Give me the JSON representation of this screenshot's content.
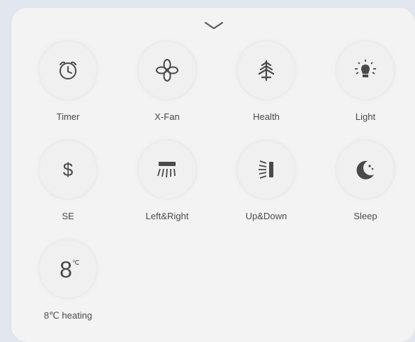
{
  "panel": {
    "collapse_icon": "chevron-down-icon"
  },
  "functions": [
    {
      "label": "Timer",
      "icon": "alarm-clock-icon"
    },
    {
      "label": "X-Fan",
      "icon": "fan-icon"
    },
    {
      "label": "Health",
      "icon": "tree-icon"
    },
    {
      "label": "Light",
      "icon": "light-bulb-icon"
    },
    {
      "label": "SE",
      "icon": "dollar-icon"
    },
    {
      "label": "Left&Right",
      "icon": "left-right-swing-icon"
    },
    {
      "label": "Up&Down",
      "icon": "up-down-swing-icon"
    },
    {
      "label": "Sleep",
      "icon": "sleep-moon-icon"
    },
    {
      "label": "8℃ heating",
      "icon": "eight-degree-heating-icon"
    }
  ],
  "colors": {
    "background": "#e2e7ef",
    "panel": "#f3f3f3",
    "icon": "#4a4a4a",
    "text": "#4a4a4a"
  }
}
